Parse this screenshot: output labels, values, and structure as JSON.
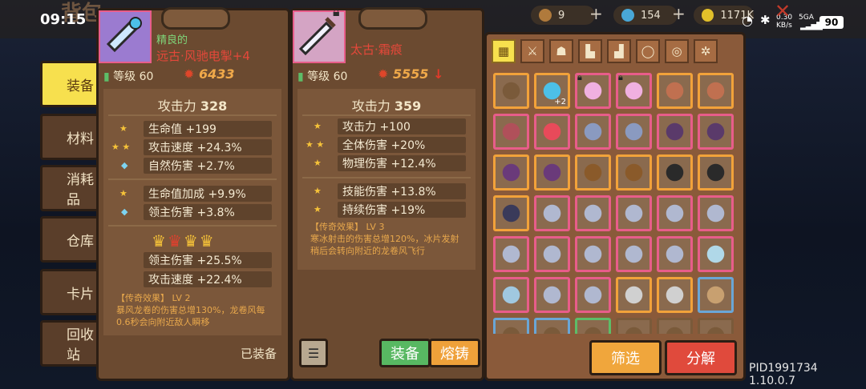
{
  "status": {
    "time": "09:15",
    "net_speed": "0.30",
    "net_unit": "KB/s",
    "net_type": "5GA",
    "battery": "90"
  },
  "header": {
    "title": "背包"
  },
  "currencies": [
    {
      "icon": "pouch-icon",
      "value": "9",
      "color": "#b07a3c"
    },
    {
      "icon": "gem-icon",
      "value": "154",
      "color": "#49a7d6"
    },
    {
      "icon": "coin-icon",
      "value": "1171K",
      "color": "#e2c02a"
    }
  ],
  "left_tabs": [
    "装备",
    "材料",
    "消耗品",
    "仓库",
    "卡片",
    "回收站"
  ],
  "equipped_item": {
    "quality": "精良的",
    "name": "远古·风驰电掣+4",
    "level_label": "等级 60",
    "power": "6433",
    "main_stat": {
      "label": "攻击力",
      "value": "328"
    },
    "stats_a": [
      {
        "stars": "★",
        "text": "生命值 +199"
      },
      {
        "stars": "★ ★",
        "text": "攻击速度 +24.3%"
      },
      {
        "stars": "◆",
        "text": "自然伤害 +2.7%"
      }
    ],
    "stats_b": [
      {
        "stars": "★",
        "text": "生命值加成 +9.9%"
      },
      {
        "stars": "◆",
        "text": "领主伤害 +3.8%"
      }
    ],
    "stats_c": [
      "领主伤害 +25.5%",
      "攻击速度 +22.4%"
    ],
    "legend_title": "【传奇效果】 LV 2",
    "legend_text": "暴风龙卷的伤害总增130%，龙卷风每0.6秒会向附近敌人瞬移",
    "status_label": "已装备"
  },
  "compare_item": {
    "name": "太古·霜痕",
    "level_label": "等级 60",
    "power": "5555",
    "main_stat": {
      "label": "攻击力",
      "value": "359"
    },
    "stats_a": [
      {
        "stars": "★",
        "text": "攻击力 +100"
      },
      {
        "stars": "★ ★",
        "text": "全体伤害 +20%"
      },
      {
        "stars": "★",
        "text": "物理伤害 +12.4%"
      }
    ],
    "stats_b": [
      {
        "stars": "★",
        "text": "技能伤害 +13.8%"
      },
      {
        "stars": "★",
        "text": "持续伤害 +19%"
      }
    ],
    "legend_title": "【传奇效果】 LV 3",
    "legend_text": "寒冰射击的伤害总增120%，冰片发射稍后会转向附近的龙卷风飞行",
    "equip_label": "装备",
    "forge_label": "熔铸"
  },
  "inventory": {
    "category_icons": [
      "grid-icon",
      "sword-icon",
      "helmet-icon",
      "armor-icon",
      "boots-icon",
      "ring-icon",
      "necklace-icon",
      "gear-icon"
    ],
    "badges": {
      "slot_2": "+2"
    },
    "filter_label": "筛选",
    "decompose_label": "分解"
  },
  "footer": {
    "pid": "PID1991734 1.10.0.7"
  }
}
